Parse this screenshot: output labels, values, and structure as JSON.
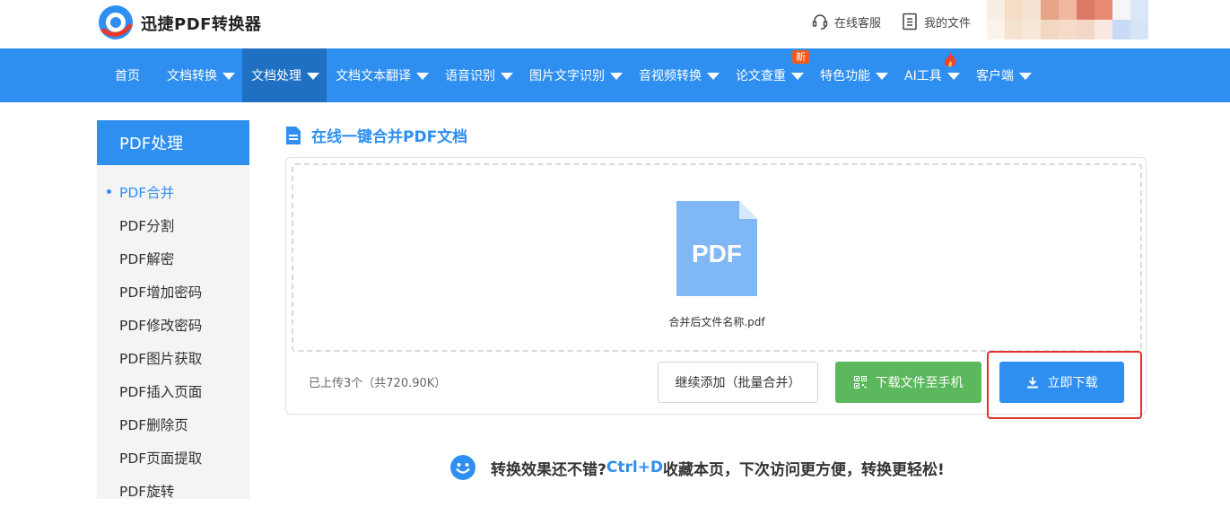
{
  "header": {
    "brand": "迅捷PDF转换器",
    "links": [
      {
        "label": "在线客服",
        "icon": "headset-icon"
      },
      {
        "label": "我的文件",
        "icon": "file-list-icon"
      }
    ]
  },
  "nav": {
    "items": [
      {
        "label": "首页",
        "dropdown": false
      },
      {
        "label": "文档转换",
        "dropdown": true
      },
      {
        "label": "文档处理",
        "dropdown": true,
        "active": true
      },
      {
        "label": "文档文本翻译",
        "dropdown": true
      },
      {
        "label": "语音识别",
        "dropdown": true
      },
      {
        "label": "图片文字识别",
        "dropdown": true
      },
      {
        "label": "音视频转换",
        "dropdown": true
      },
      {
        "label": "论文查重",
        "dropdown": true
      },
      {
        "label": "特色功能",
        "dropdown": true
      },
      {
        "label": "AI工具",
        "dropdown": true
      },
      {
        "label": "客户端",
        "dropdown": true
      }
    ],
    "new_badge": "新"
  },
  "sidebar": {
    "title": "PDF处理",
    "items": [
      {
        "label": "PDF合并",
        "active": true
      },
      {
        "label": "PDF分割"
      },
      {
        "label": "PDF解密"
      },
      {
        "label": "PDF增加密码"
      },
      {
        "label": "PDF修改密码"
      },
      {
        "label": "PDF图片获取"
      },
      {
        "label": "PDF插入页面"
      },
      {
        "label": "PDF删除页"
      },
      {
        "label": "PDF页面提取"
      },
      {
        "label": "PDF旋转"
      }
    ]
  },
  "main": {
    "title": "在线一键合并PDF文档",
    "file_icon_text": "PDF",
    "file_name": "合并后文件名称.pdf",
    "upload_info": "已上传3个（共720.90K）",
    "buttons": {
      "add": "继续添加（批量合并）",
      "to_phone": "下载文件至手机",
      "download": "立即下载"
    },
    "tip": {
      "before": "转换效果还不错?",
      "shortcut": "Ctrl+D",
      "after": "收藏本页，下次访问更方便，转换更轻松!"
    }
  },
  "colors": {
    "primary": "#2f8ff0",
    "nav_active": "#1f6fc3",
    "green": "#5bb85d",
    "highlight_red": "#e0322e",
    "badge_orange": "#f55b1c"
  }
}
